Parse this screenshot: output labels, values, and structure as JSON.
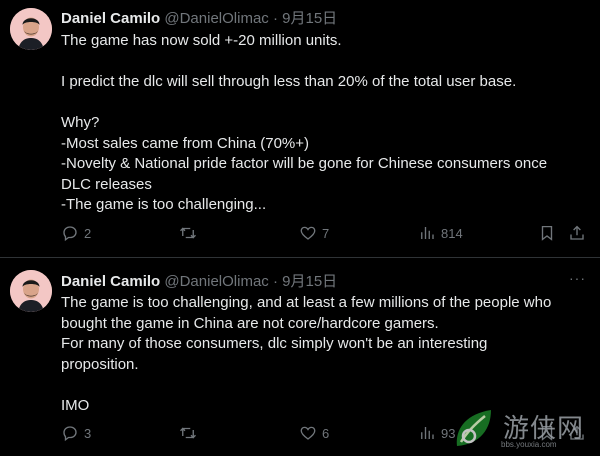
{
  "tweets": [
    {
      "author_name": "Daniel Camilo",
      "handle": "@DanielOlimac",
      "separator": "·",
      "date": "9月15日",
      "lines": [
        "The game has now sold +-20 million units.",
        "",
        "I predict the dlc will sell through less than 20% of the total user base.",
        "",
        "Why?",
        "-Most sales came from China (70%+)",
        "-Novelty & National pride factor will be gone for Chinese consumers once",
        "DLC releases",
        "-The game is too challenging..."
      ],
      "replies": "2",
      "reposts": "",
      "likes": "7",
      "views": "814"
    },
    {
      "author_name": "Daniel Camilo",
      "handle": "@DanielOlimac",
      "separator": "·",
      "date": "9月15日",
      "more": "···",
      "lines": [
        "The game is too challenging, and at least a few millions of the people who",
        "bought the game in China are not core/hardcore gamers.",
        "For many of those consumers, dlc simply won't be an interesting",
        "proposition.",
        "",
        "IMO"
      ],
      "replies": "3",
      "reposts": "",
      "likes": "6",
      "views": "93"
    }
  ],
  "watermark": {
    "text": "游侠网",
    "url": "bbs.youxia.com"
  },
  "colors": {
    "background": "#000000",
    "text": "#e7e9ea",
    "muted": "#71767b",
    "divider": "#2f3336",
    "avatar_bg": "#f3c7c5"
  },
  "icons": [
    "reply-icon",
    "repost-icon",
    "like-icon",
    "views-icon",
    "bookmark-icon",
    "share-icon",
    "more-icon"
  ]
}
